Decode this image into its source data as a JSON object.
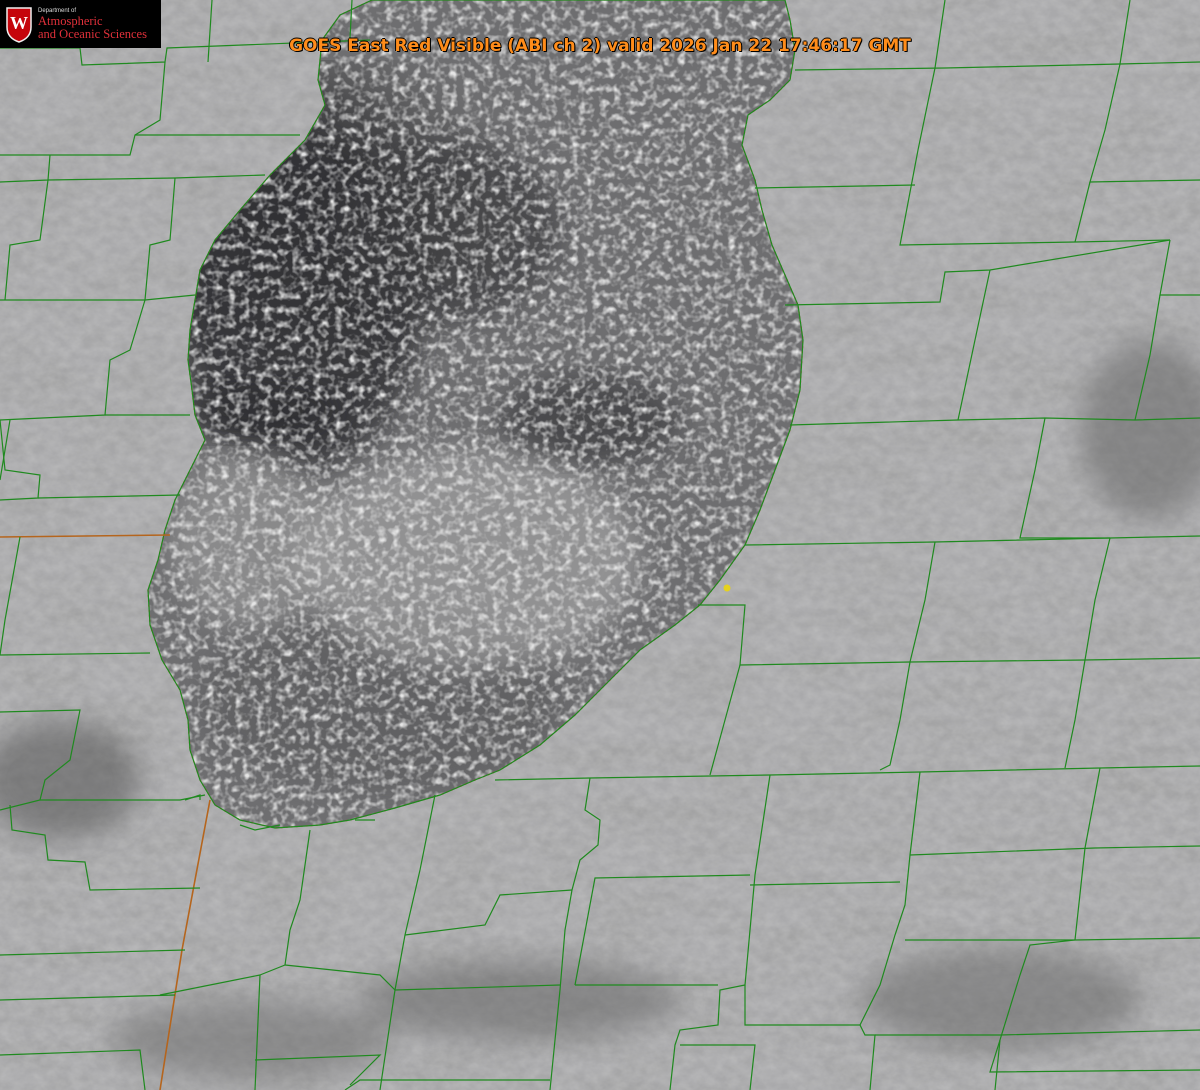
{
  "header": {
    "title": "GOES East Red Visible (ABI ch 2) valid 2026 Jan 22 17:46:17 GMT"
  },
  "logo": {
    "department_line": "Department of",
    "name_line1": "Atmospheric",
    "name_line2": "and Oceanic Sciences",
    "seal_letter": "W"
  },
  "map": {
    "county_line_color": "#1f8a1f",
    "state_line_color": "#b5651d",
    "lake_outline_color": "#e0303a",
    "marker_color": "#e6d21e"
  }
}
